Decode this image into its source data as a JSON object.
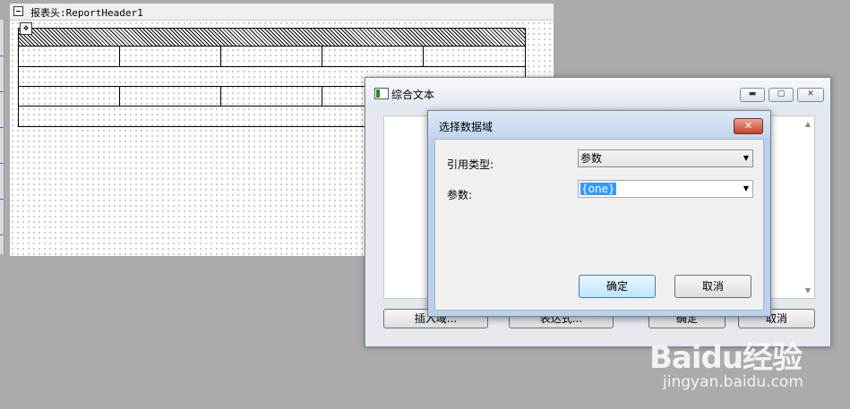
{
  "designer": {
    "band_title": "报表头:ReportHeader1",
    "move_handle_glyph": "✥"
  },
  "rich_text_dialog": {
    "title": "综合文本",
    "window_buttons": {
      "minimize": "▬",
      "maximize": "▢",
      "close": "✕"
    },
    "buttons": {
      "insert_field": "插入域...",
      "expression": "表达式...",
      "ok": "确定",
      "cancel": "取消"
    }
  },
  "select_field_dialog": {
    "title": "选择数据域",
    "close_glyph": "✕",
    "reference_type_label": "引用类型:",
    "reference_type_value": "参数",
    "parameter_label": "参数:",
    "parameter_value": "{one}",
    "ok": "确定",
    "cancel": "取消"
  },
  "watermark": {
    "logo_text": "Baidu经验",
    "url": "jingyan.baidu.com"
  }
}
